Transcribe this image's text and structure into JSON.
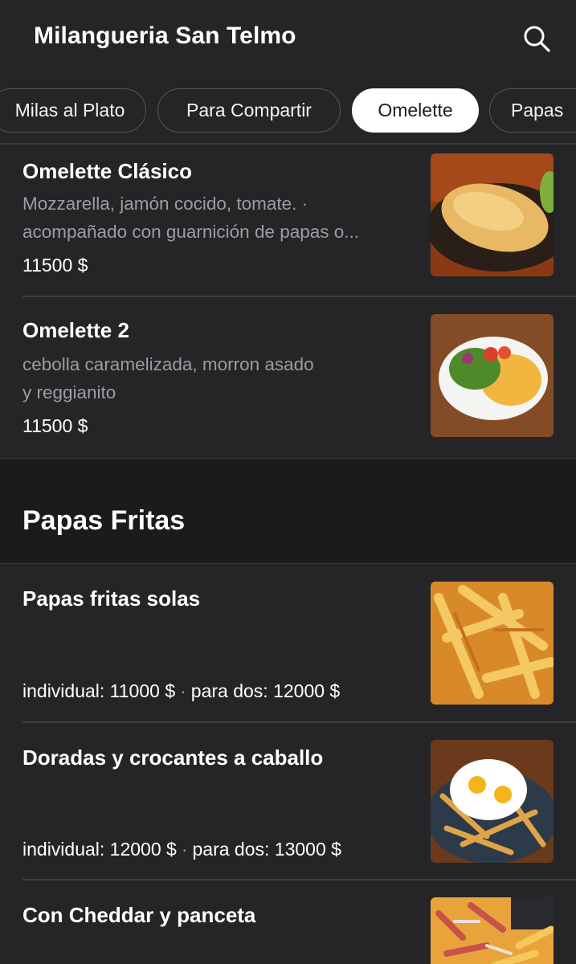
{
  "header": {
    "title": "Milangueria San Telmo",
    "search_icon": "search-icon"
  },
  "tabs": [
    {
      "label": "Milas al Plato",
      "active": false
    },
    {
      "label": "Para Compartir",
      "active": false
    },
    {
      "label": "Omelette",
      "active": true
    },
    {
      "label": "Papas",
      "active": false
    }
  ],
  "omelette_items": [
    {
      "name": "Omelette Clásico",
      "desc_line1": "Mozzarella, jamón cocido, tomate. ·",
      "desc_line2": "acompañado con guarnición de papas o...",
      "price": "11500 $"
    },
    {
      "name": "Omelette 2",
      "desc_line1": "cebolla caramelizada, morron asado",
      "desc_line2": "y reggianito",
      "price": "11500 $"
    }
  ],
  "papas_section": {
    "title": "Papas Fritas",
    "items": [
      {
        "name": "Papas fritas solas",
        "price_a": "individual: 11000 $",
        "separator": "·",
        "price_b": "para dos: 12000 $"
      },
      {
        "name": "Doradas y crocantes a caballo",
        "price_a": "individual: 12000 $",
        "separator": "·",
        "price_b": "para dos: 13000 $"
      },
      {
        "name": "Con Cheddar y panceta"
      }
    ]
  },
  "colors": {
    "background": "#252527",
    "section_band": "#1b1b1d",
    "muted_text": "#9c9ca2",
    "active_tab": "#ffffff"
  }
}
